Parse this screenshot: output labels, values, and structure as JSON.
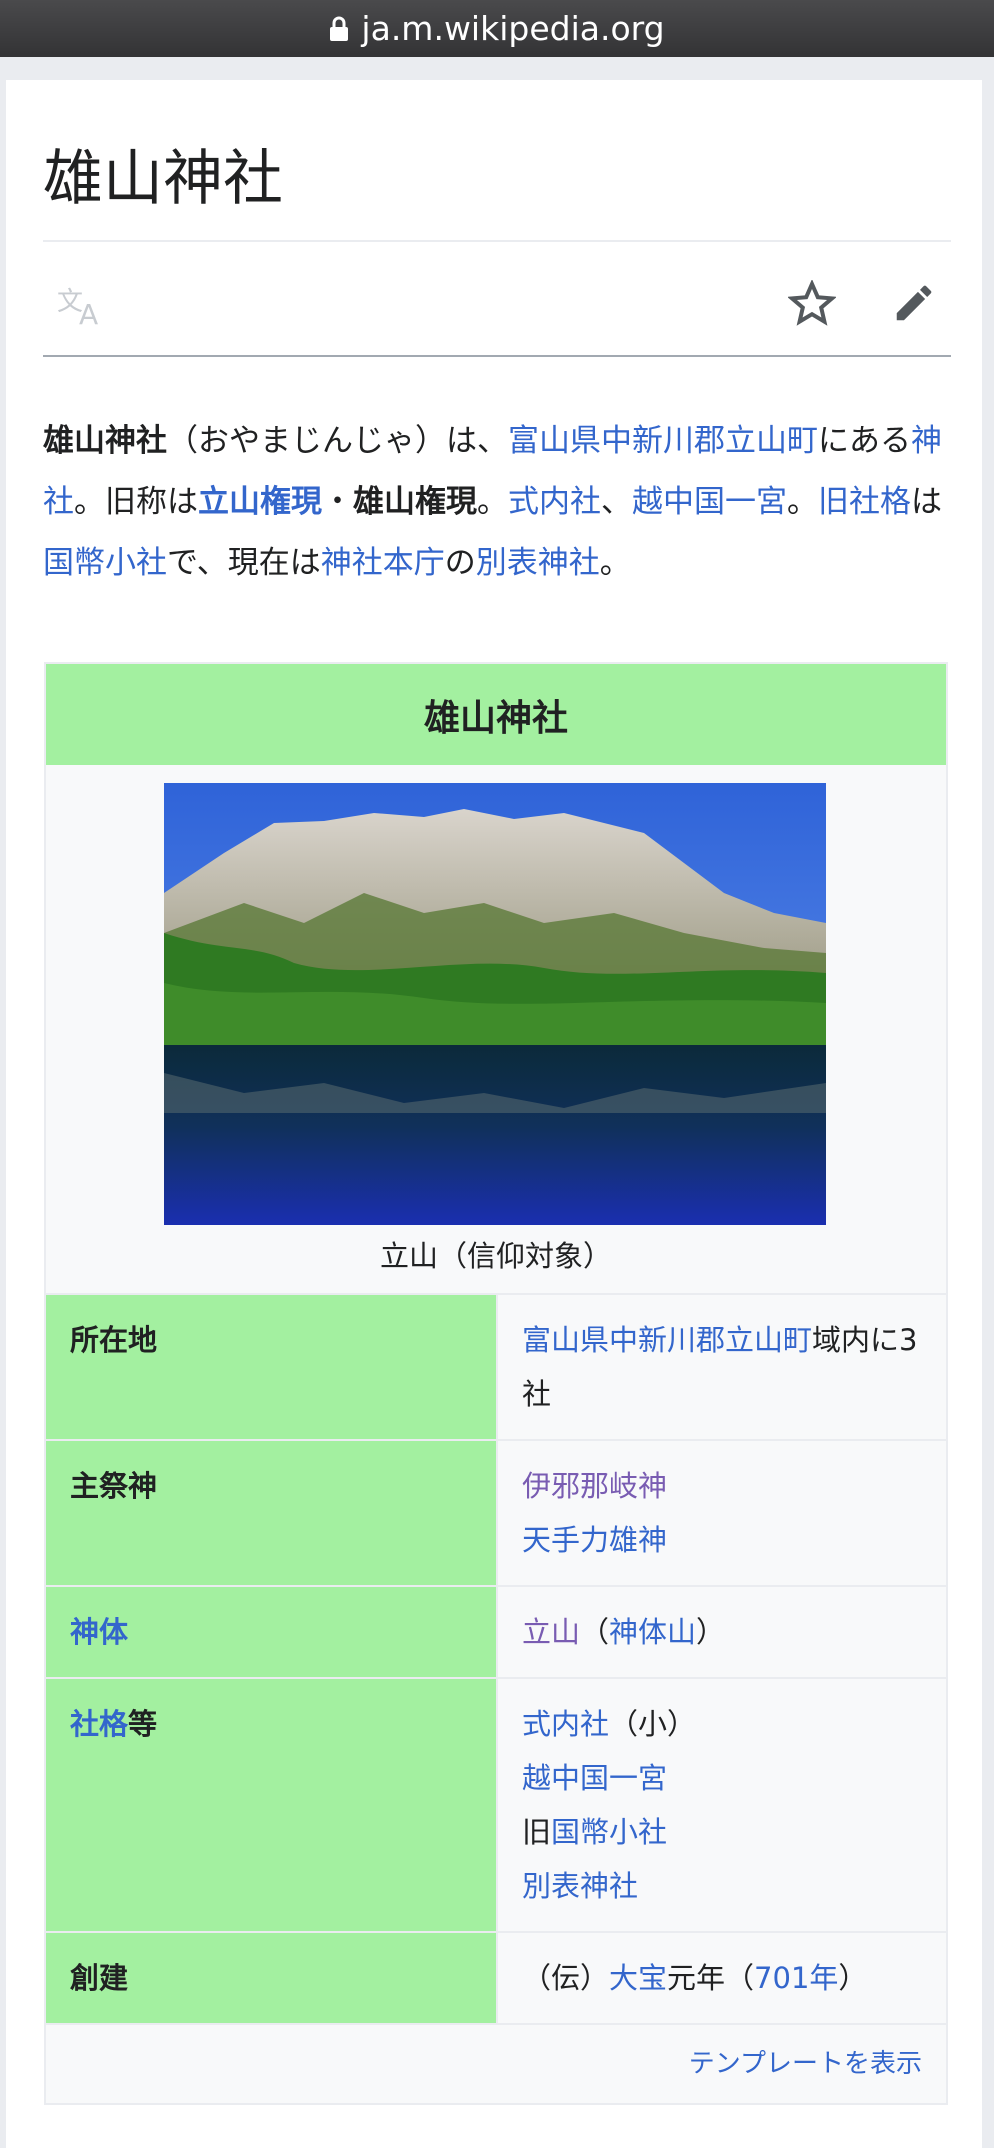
{
  "browser": {
    "url": "ja.m.wikipedia.org"
  },
  "article": {
    "title": "雄山神社",
    "lead": [
      {
        "t": "雄山神社",
        "s": "b"
      },
      {
        "t": "（おやまじんじゃ）は、"
      },
      {
        "t": "富山県",
        "s": "a"
      },
      {
        "t": "中新川郡",
        "s": "a"
      },
      {
        "t": "立山町",
        "s": "a"
      },
      {
        "t": "にある"
      },
      {
        "t": "神社",
        "s": "a"
      },
      {
        "t": "。旧称は"
      },
      {
        "t": "立山権現",
        "s": "ab"
      },
      {
        "t": "・"
      },
      {
        "t": "雄山権現",
        "s": "b"
      },
      {
        "t": "。"
      },
      {
        "t": "式内社",
        "s": "a"
      },
      {
        "t": "、"
      },
      {
        "t": "越中国一宮",
        "s": "a"
      },
      {
        "t": "。"
      },
      {
        "t": "旧社格",
        "s": "a"
      },
      {
        "t": "は"
      },
      {
        "t": "国幣小社",
        "s": "a"
      },
      {
        "t": "で、現在は"
      },
      {
        "t": "神社本庁",
        "s": "a"
      },
      {
        "t": "の"
      },
      {
        "t": "別表神社",
        "s": "a"
      },
      {
        "t": "。"
      }
    ]
  },
  "infobox": {
    "header": "雄山神社",
    "image_caption": "立山（信仰対象）",
    "rows": {
      "location": {
        "label": "所在地",
        "pref": "富山県",
        "county": "中新川郡",
        "town": "立山町",
        "suffix": "域内に3社"
      },
      "deity": {
        "label": "主祭神",
        "deity1": "伊邪那岐神",
        "deity2": "天手力雄神"
      },
      "body": {
        "label": "神体",
        "mountain": "立山",
        "open": "（",
        "type": "神体山",
        "close": "）"
      },
      "rank": {
        "label_link": "社格",
        "label_suffix": "等",
        "r1": "式内社",
        "r1_suffix": "（小）",
        "r2": "越中国一宮",
        "r3_prefix": "旧",
        "r3": "国幣小社",
        "r4": "別表神社"
      },
      "founded": {
        "label": "創建",
        "p1": "（伝）",
        "era": "大宝",
        "p2": "元年（",
        "year": "701年",
        "p3": "）"
      }
    },
    "footer_link": "テンプレートを表示"
  },
  "icons": {
    "lock": "lock-icon",
    "language": "language-icon",
    "star": "star-icon",
    "edit": "pencil-icon"
  },
  "colors": {
    "link": "#3366cc",
    "visited_link": "#795cb2",
    "infobox_header": "#a3f0a0",
    "text": "#202122"
  }
}
